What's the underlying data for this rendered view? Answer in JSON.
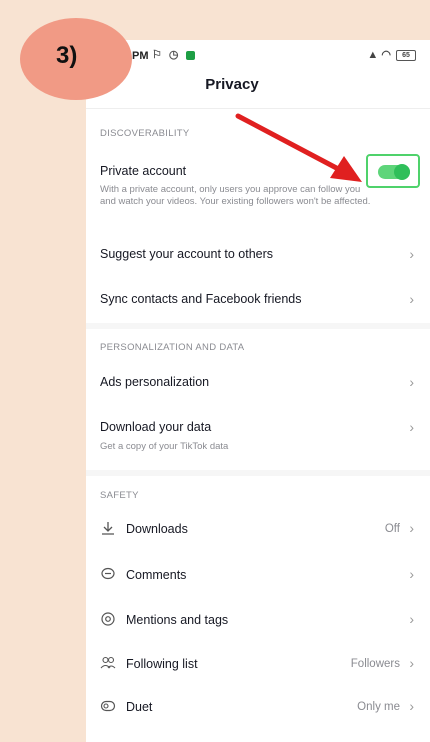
{
  "step_badge": "3)",
  "status": {
    "time": "PM",
    "battery": "65"
  },
  "header": {
    "title": "Privacy"
  },
  "discoverability": {
    "label": "DISCOVERABILITY",
    "private_account": {
      "title": "Private account",
      "description_line1": "With a private account, only users you approve can follow you",
      "description_line2": "and watch your videos. Your existing followers won't be affected.",
      "enabled": true
    },
    "suggest": "Suggest your account to others",
    "sync": "Sync contacts and Facebook friends"
  },
  "personalization": {
    "label": "PERSONALIZATION AND DATA",
    "ads": "Ads personalization",
    "download_title": "Download your data",
    "download_sub": "Get a copy of your TikTok data"
  },
  "safety": {
    "label": "SAFETY",
    "items": [
      {
        "label": "Downloads",
        "value": "Off",
        "icon": "download-icon"
      },
      {
        "label": "Comments",
        "value": "",
        "icon": "comment-icon"
      },
      {
        "label": "Mentions and tags",
        "value": "",
        "icon": "at-icon"
      },
      {
        "label": "Following list",
        "value": "Followers",
        "icon": "people-icon"
      },
      {
        "label": "Duet",
        "value": "Only me",
        "icon": "duet-icon"
      }
    ]
  },
  "colors": {
    "accent_green": "#2fbf5a",
    "arrow_red": "#e02020",
    "badge": "#f19a85",
    "background": "#f8e3d2"
  }
}
